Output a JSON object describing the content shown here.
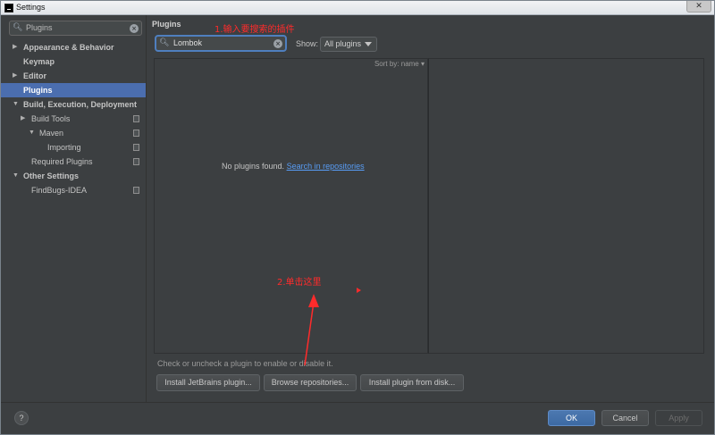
{
  "window": {
    "title": "Settings",
    "close_glyph": "✕"
  },
  "left": {
    "search": {
      "icon": "search-icon",
      "value": "Plugins"
    },
    "tree": [
      {
        "label": "Appearance & Behavior",
        "arrow": "▶",
        "bold": true
      },
      {
        "label": "Keymap",
        "arrow": "",
        "bold": true
      },
      {
        "label": "Editor",
        "arrow": "▶",
        "bold": true
      },
      {
        "label": "Plugins",
        "arrow": "",
        "bold": true,
        "selected": true
      },
      {
        "label": "Build, Execution, Deployment",
        "arrow": "▼",
        "bold": true
      },
      {
        "label": "Build Tools",
        "arrow": "▶",
        "bold": false,
        "proj": true
      },
      {
        "label": "Maven",
        "arrow": "▼",
        "bold": false,
        "proj": true
      },
      {
        "label": "Importing",
        "arrow": "",
        "bold": false,
        "proj": true
      },
      {
        "label": "Required Plugins",
        "arrow": "",
        "bold": false,
        "proj": true
      },
      {
        "label": "Other Settings",
        "arrow": "▼",
        "bold": true
      },
      {
        "label": "FindBugs-IDEA",
        "arrow": "",
        "bold": false,
        "proj": true
      }
    ]
  },
  "plugins": {
    "title": "Plugins",
    "search": {
      "icon": "search-icon",
      "value": "Lombok"
    },
    "show_label": "Show:",
    "show_value": "All plugins",
    "sort_by": "Sort by: name ▾",
    "empty_text": "No plugins found. ",
    "empty_link": "Search in repositories",
    "hint": "Check or uncheck a plugin to enable or disable it.",
    "buttons": {
      "install_jetbrains": "Install JetBrains plugin...",
      "browse_repos": "Browse repositories...",
      "install_disk": "Install plugin from disk..."
    }
  },
  "annotations": {
    "step1": "1.输入要搜索的插件",
    "step2": "2.单击这里",
    "color": "#ff2b2b"
  },
  "footer": {
    "help": "?",
    "ok": "OK",
    "cancel": "Cancel",
    "apply": "Apply"
  },
  "colors": {
    "background": "#3c3f41",
    "selection": "#4b6eaf",
    "link": "#589df6",
    "focus": "#4f7fbf"
  }
}
